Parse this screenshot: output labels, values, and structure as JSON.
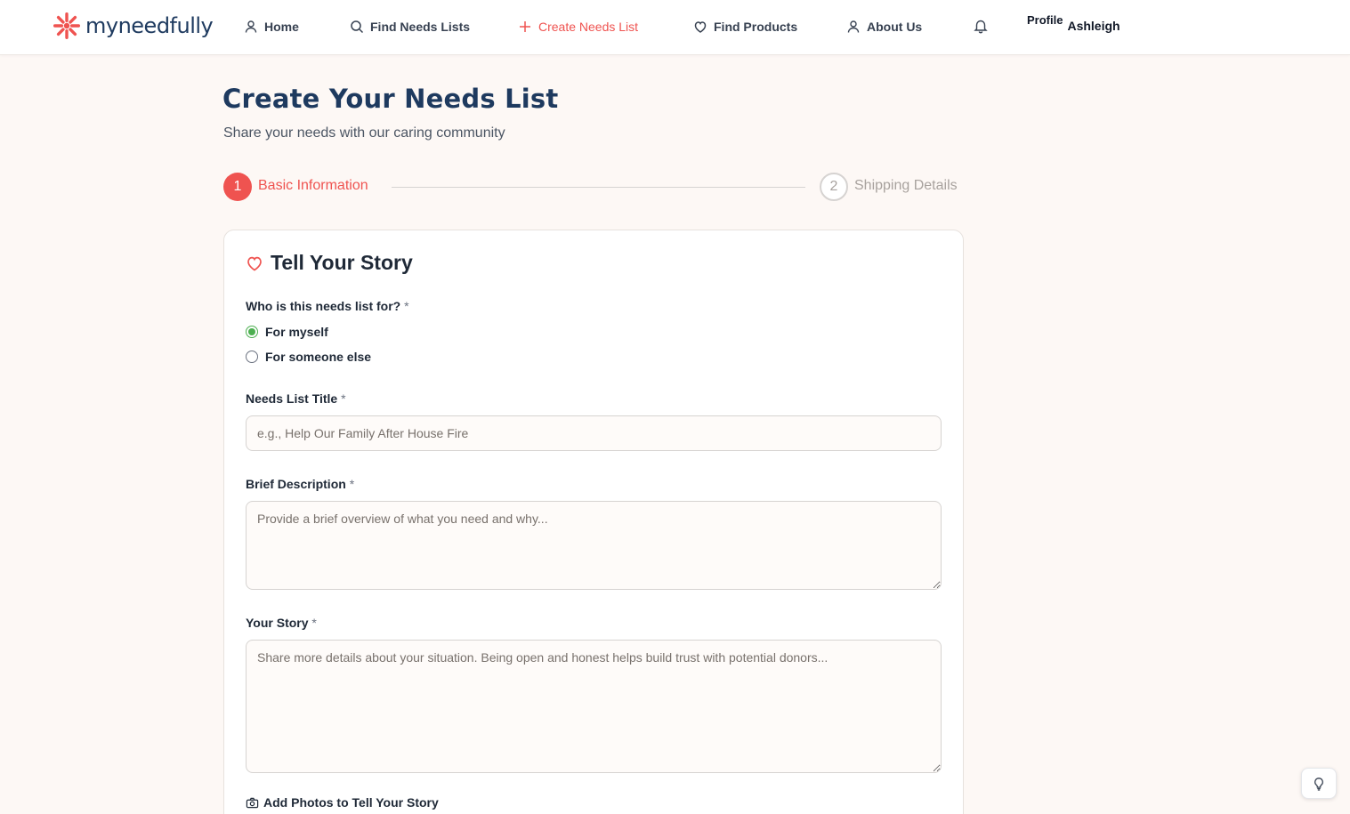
{
  "brand": {
    "name": "myneedfully",
    "color": "#ef5350",
    "navy": "#1e3a5f"
  },
  "nav": {
    "home": "Home",
    "find_lists": "Find Needs Lists",
    "create_list": "Create Needs List",
    "find_products": "Find Products",
    "about": "About Us"
  },
  "profile": {
    "label": "Profile",
    "name": "Ashleigh"
  },
  "page": {
    "title": "Create Your Needs List",
    "subtitle": "Share your needs with our caring community"
  },
  "stepper": {
    "steps": [
      {
        "number": "1",
        "label": "Basic Information",
        "state": "active"
      },
      {
        "number": "2",
        "label": "Shipping Details",
        "state": "inactive"
      }
    ]
  },
  "form": {
    "section_title": "Tell Your Story",
    "recipient": {
      "label": "Who is this needs list for?",
      "required_mark": "*",
      "options": [
        "For myself",
        "For someone else"
      ],
      "selected": "For myself"
    },
    "title_field": {
      "label": "Needs List Title",
      "required_mark": "*",
      "value": "",
      "placeholder": "e.g., Help Our Family After House Fire"
    },
    "description_field": {
      "label": "Brief Description",
      "required_mark": "*",
      "value": "",
      "placeholder": "Provide a brief overview of what you need and why..."
    },
    "story_field": {
      "label": "Your Story",
      "required_mark": "*",
      "value": "",
      "placeholder": "Share more details about your situation. Being open and honest helps build trust with potential donors..."
    },
    "photos_label": "Add Photos to Tell Your Story"
  },
  "icons": {
    "home": "user-icon",
    "find": "search-icon",
    "create": "plus-icon",
    "products": "heart-icon",
    "about": "user-icon",
    "notifications": "bell-icon",
    "story": "heart-icon",
    "photos": "camera-icon",
    "tips": "lightbulb-icon"
  }
}
